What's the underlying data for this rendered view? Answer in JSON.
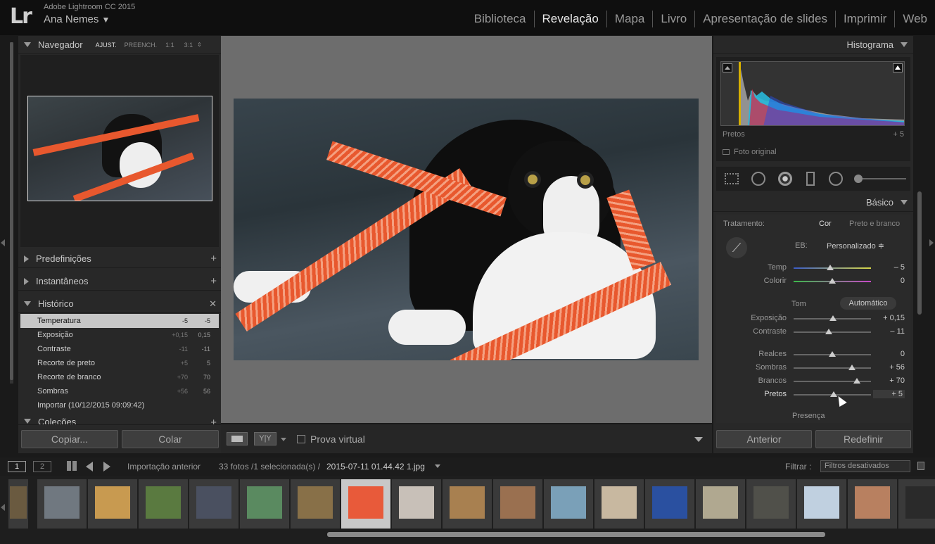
{
  "app": {
    "name": "Adobe Lightroom CC 2015",
    "user": "Ana Nemes",
    "logo": "Lr"
  },
  "modules": [
    "Biblioteca",
    "Revelação",
    "Mapa",
    "Livro",
    "Apresentação de slides",
    "Imprimir",
    "Web"
  ],
  "navigator": {
    "title": "Navegador",
    "zoom": [
      "AJUST.",
      "PREENCH.",
      "1:1",
      "3:1"
    ]
  },
  "left_panels": {
    "presets": "Predefinições",
    "snapshots": "Instantâneos",
    "history": "Histórico",
    "collections": "Coleções"
  },
  "history": [
    {
      "name": "Temperatura",
      "v1": "-5",
      "v2": "-5"
    },
    {
      "name": "Exposição",
      "v1": "+0,15",
      "v2": "0,15"
    },
    {
      "name": "Contraste",
      "v1": "-11",
      "v2": "-11"
    },
    {
      "name": "Recorte de preto",
      "v1": "+5",
      "v2": "5"
    },
    {
      "name": "Recorte de branco",
      "v1": "+70",
      "v2": "70"
    },
    {
      "name": "Sombras",
      "v1": "+56",
      "v2": "56"
    },
    {
      "name": "Importar (10/12/2015 09:09:42)",
      "v1": "",
      "v2": ""
    }
  ],
  "left_buttons": {
    "copy": "Copiar...",
    "paste": "Colar"
  },
  "toolbar": {
    "proof": "Prova virtual",
    "yy": "Y|Y"
  },
  "histogram": {
    "title": "Histograma",
    "label_left": "Pretos",
    "label_right": "+ 5",
    "original": "Foto original"
  },
  "basic": {
    "title": "Básico",
    "treatment": "Tratamento:",
    "color": "Cor",
    "bw": "Preto e branco",
    "wb_label": "EB:",
    "wb_value": "Personalizado ≑",
    "tone": "Tom",
    "auto": "Automático",
    "presence": "Presença",
    "sliders": [
      {
        "name": "Temp",
        "value": "– 5",
        "pos": 0.47
      },
      {
        "name": "Colorir",
        "value": "0",
        "pos": 0.5
      },
      {
        "name": "Exposição",
        "value": "+ 0,15",
        "pos": 0.51
      },
      {
        "name": "Contraste",
        "value": "– 11",
        "pos": 0.45
      },
      {
        "name": "Realces",
        "value": "0",
        "pos": 0.5
      },
      {
        "name": "Sombras",
        "value": "+ 56",
        "pos": 0.75
      },
      {
        "name": "Brancos",
        "value": "+ 70",
        "pos": 0.82
      },
      {
        "name": "Pretos",
        "value": "+ 5",
        "pos": 0.52
      }
    ]
  },
  "right_buttons": {
    "prev": "Anterior",
    "reset": "Redefinir"
  },
  "filmstrip": {
    "import": "Importação anterior",
    "info": "33 fotos /1 selecionada(s) /",
    "filename": "2015-07-11 01.44.42 1.jpg",
    "filter_label": "Filtrar :",
    "filter_value": "Filtros desativados",
    "page1": "1",
    "page2": "2"
  },
  "colors": {
    "accent": "#e8582e",
    "bg": "#282828"
  }
}
